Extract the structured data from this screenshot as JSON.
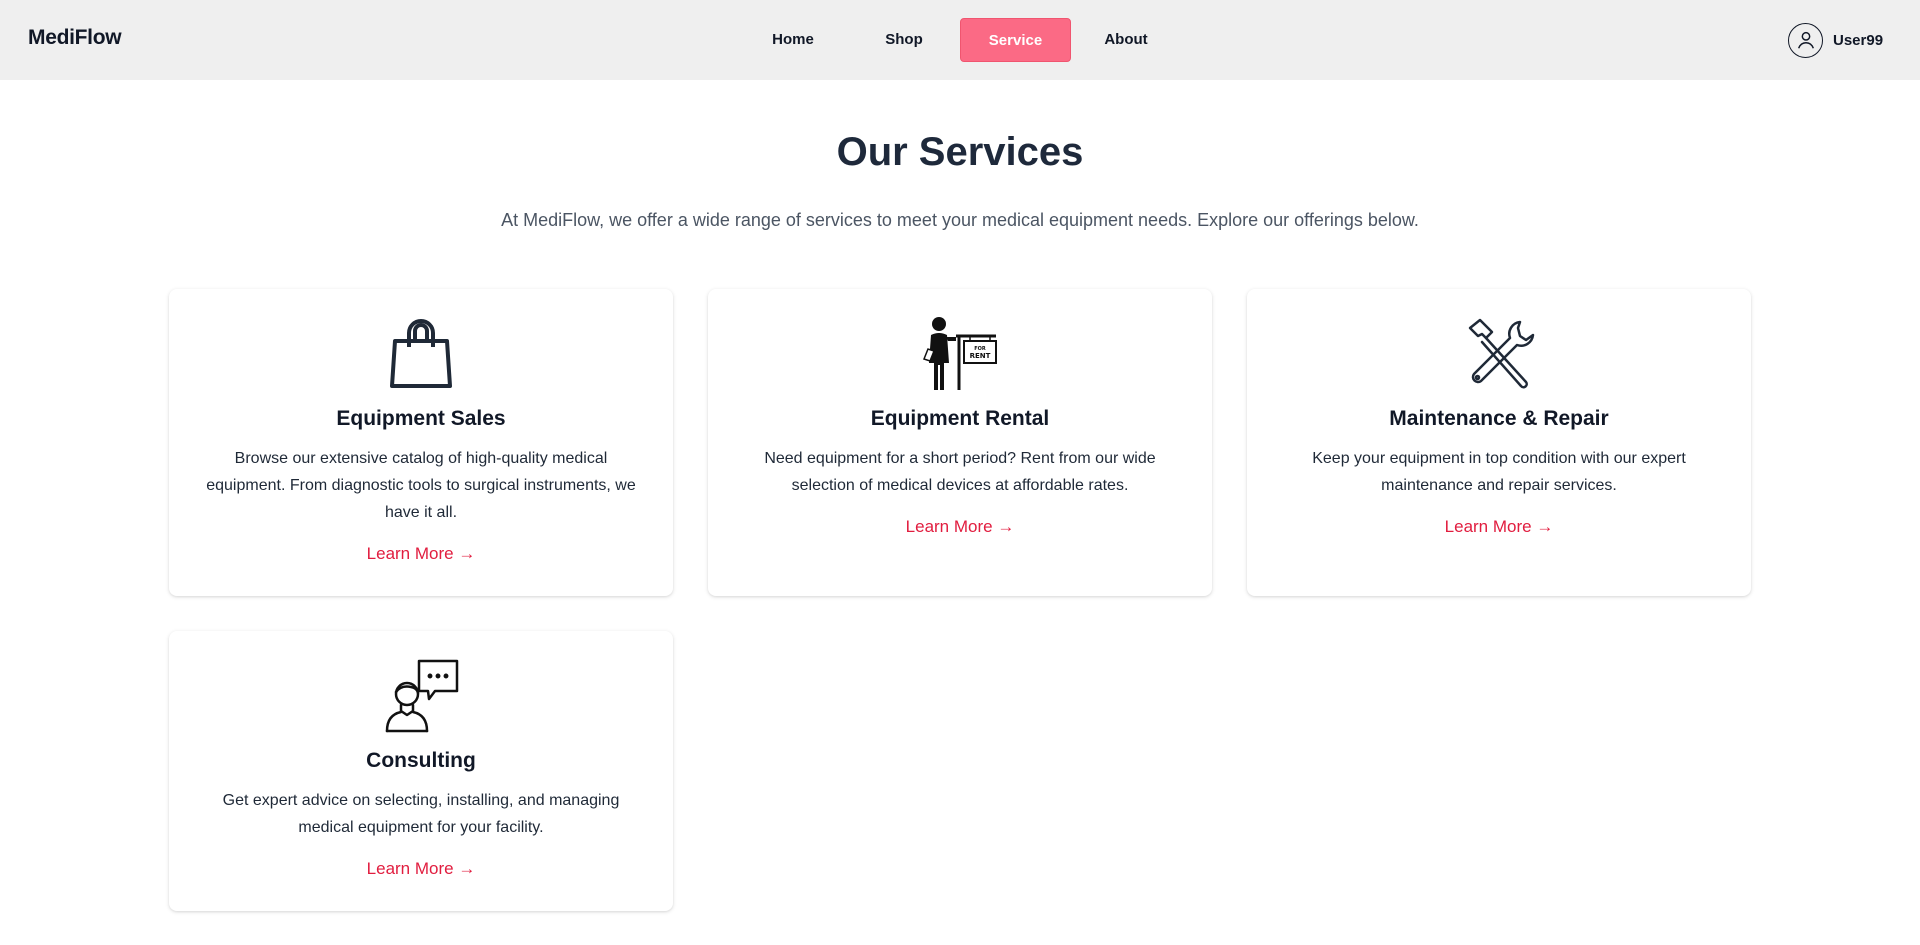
{
  "header": {
    "brand": "MediFlow",
    "nav": [
      {
        "label": "Home",
        "active": false
      },
      {
        "label": "Shop",
        "active": false
      },
      {
        "label": "Service",
        "active": true
      },
      {
        "label": "About",
        "active": false
      }
    ],
    "user": {
      "name": "User99",
      "icon": "user-circle-icon"
    }
  },
  "main": {
    "title": "Our Services",
    "subtitle": "At MediFlow, we offer a wide range of services to meet your medical equipment needs. Explore our offerings below.",
    "services": [
      {
        "icon": "shopping-bag-icon",
        "title": "Equipment Sales",
        "description": "Browse our extensive catalog of high-quality medical equipment. From diagnostic tools to surgical instruments, we have it all.",
        "link": "Learn More →"
      },
      {
        "icon": "for-rent-person-icon",
        "title": "Equipment Rental",
        "description": "Need equipment for a short period? Rent from our wide selection of medical devices at affordable rates.",
        "link": "Learn More →",
        "icon_sign_top": "FOR",
        "icon_sign_bottom": "RENT"
      },
      {
        "icon": "hammer-wrench-icon",
        "title": "Maintenance & Repair",
        "description": "Keep your equipment in top condition with our expert maintenance and repair services.",
        "link": "Learn More →"
      },
      {
        "icon": "consultant-chat-icon",
        "title": "Consulting",
        "description": "Get expert advice on selecting, installing, and managing medical equipment for your facility.",
        "link": "Learn More →"
      }
    ]
  },
  "colors": {
    "accent": "#fb6a85",
    "link": "#e11d3f",
    "header_bg": "#efefef",
    "title": "#1e293b"
  }
}
